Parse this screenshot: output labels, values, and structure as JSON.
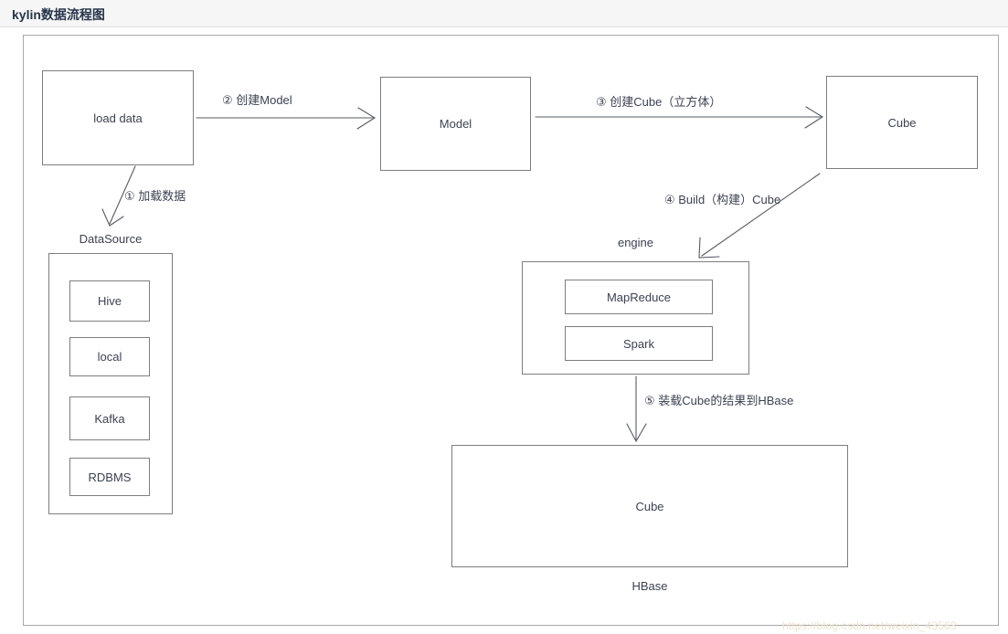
{
  "header": {
    "title": "kylin数据流程图"
  },
  "diagram": {
    "nodes": {
      "load_data": "load data",
      "model": "Model",
      "cube_top": "Cube",
      "cube_bottom": "Cube",
      "datasource_label": "DataSource",
      "hive": "Hive",
      "local": "local",
      "kafka": "Kafka",
      "rdbms": "RDBMS",
      "engine_label": "engine",
      "mapreduce": "MapReduce",
      "spark": "Spark",
      "hbase_label": "HBase"
    },
    "edges": {
      "step1": "① 加载数据",
      "step2": "② 创建Model",
      "step3": "③ 创建Cube（立方体）",
      "step4": "④ Build（构建）Cube",
      "step5": "⑤ 装载Cube的结果到HBase"
    }
  },
  "watermark": "https://blog.csdn.net/weixin_43563",
  "colors": {
    "header_bg": "#f6f6f6",
    "frame_border": "#a8a8a8",
    "node_border": "#7d7d7d",
    "text": "#3b4252",
    "title": "#26344a"
  }
}
